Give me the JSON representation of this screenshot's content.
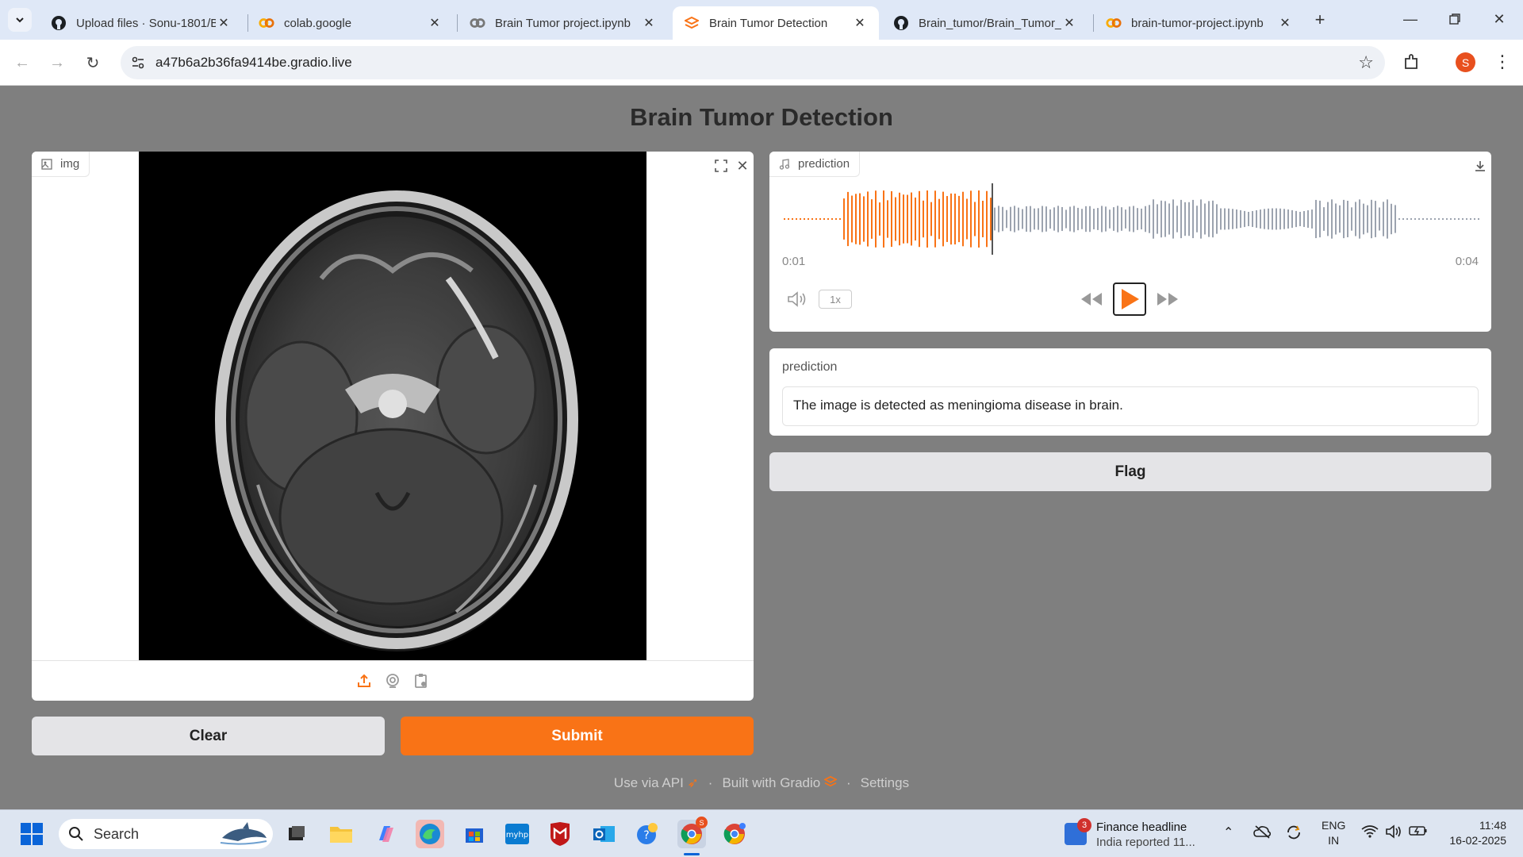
{
  "browser": {
    "tabs": [
      {
        "title": "Upload files · Sonu-1801/B",
        "icon": "github-icon",
        "active": false
      },
      {
        "title": "colab.google",
        "icon": "colab-icon",
        "active": false
      },
      {
        "title": "Brain Tumor project.ipynb",
        "icon": "colab-icon",
        "active": false
      },
      {
        "title": "Brain Tumor Detection",
        "icon": "gradio-icon",
        "active": true
      },
      {
        "title": "Brain_tumor/Brain_Tumor_",
        "icon": "github-icon",
        "active": false
      },
      {
        "title": "brain-tumor-project.ipynb",
        "icon": "colab-icon",
        "active": false
      }
    ],
    "url": "a47b6a2b36fa9414be.gradio.live",
    "profile_initial": "S",
    "accent": "#f97316"
  },
  "app": {
    "title": "Brain Tumor Detection",
    "image_input": {
      "label": "img"
    },
    "buttons": {
      "clear": "Clear",
      "submit": "Submit",
      "flag": "Flag"
    },
    "audio_output": {
      "label": "prediction",
      "current_time": "0:01",
      "duration": "0:04",
      "playback_rate": "1x",
      "progress_fraction": 0.3
    },
    "text_output": {
      "label": "prediction",
      "value": "The image is detected as meningioma disease in brain."
    },
    "footer": {
      "api": "Use via API",
      "built": "Built with Gradio",
      "settings": "Settings",
      "sep": "·"
    }
  },
  "taskbar": {
    "search_placeholder": "Search",
    "news_title": "Finance headline",
    "news_sub": "India reported 11...",
    "news_badge": "3",
    "chrome_badge": "S",
    "lang_line1": "ENG",
    "lang_line2": "IN",
    "time": "11:48",
    "date": "16-02-2025"
  }
}
